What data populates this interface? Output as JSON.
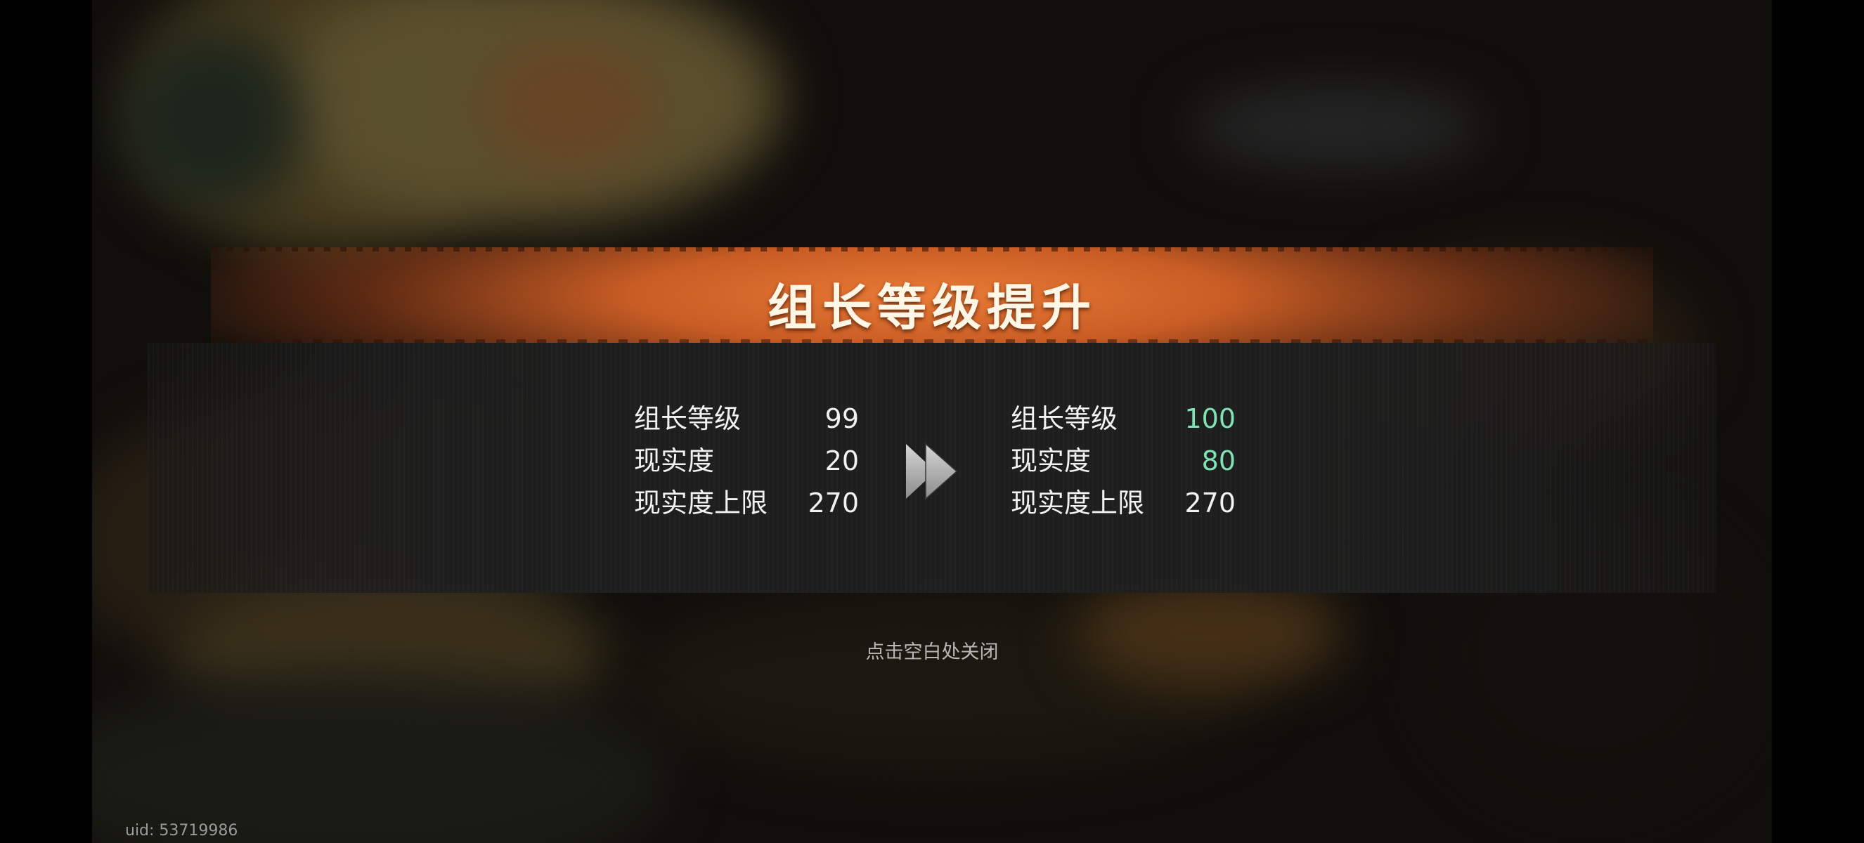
{
  "popup": {
    "title": "组长等级提升",
    "before": [
      {
        "label": "组长等级",
        "value": "99"
      },
      {
        "label": "现实度",
        "value": "20"
      },
      {
        "label": "现实度上限",
        "value": "270"
      }
    ],
    "after": [
      {
        "label": "组长等级",
        "value": "100",
        "highlight": true
      },
      {
        "label": "现实度",
        "value": "80",
        "highlight": true
      },
      {
        "label": "现实度上限",
        "value": "270",
        "highlight": false
      }
    ],
    "close_hint": "点击空白处关闭"
  },
  "footer": {
    "uid": "uid: 53719986"
  },
  "colors": {
    "banner": "#d9642a",
    "panel": "#1f1f1f",
    "increased_value": "#7fe3b4",
    "text": "#f2f2f2"
  },
  "icons": [
    "fast-forward-arrow-icon"
  ]
}
